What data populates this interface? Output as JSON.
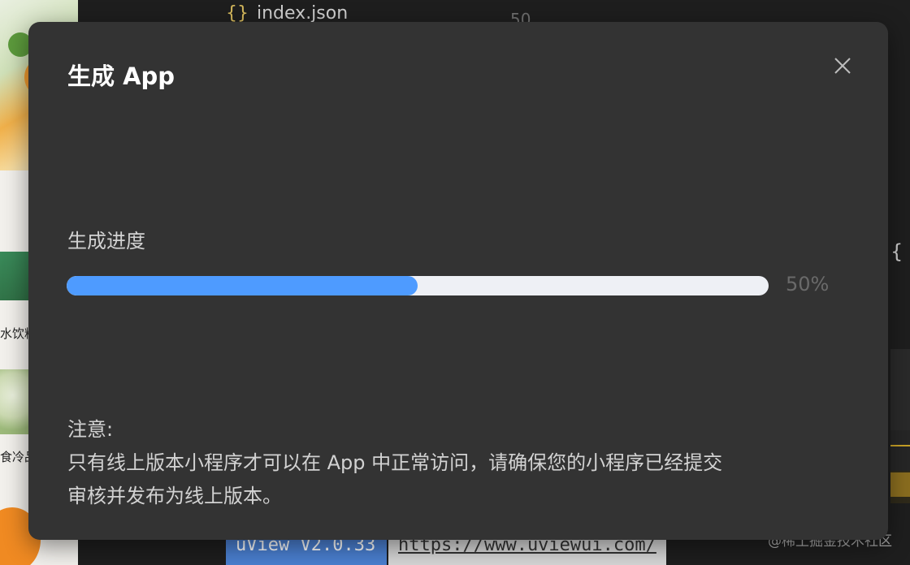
{
  "background": {
    "editor_file_name": "index.json",
    "editor_file_icon": "{}",
    "editor_line_number": "50",
    "editor_brace": "{",
    "strip_labels": [
      "水饮料",
      "食冷品"
    ],
    "bottom_bar_blue": "uView V2.0.33",
    "bottom_bar_link": "https://www.uviewui.com/",
    "watermark": "@稀土掘金技术社区"
  },
  "modal": {
    "title": "生成 App",
    "close_icon": "close-icon",
    "progress": {
      "label": "生成进度",
      "value": 0.5,
      "percent_text": "50%",
      "fill_color": "#4e9bff",
      "track_color": "#eef0f5"
    },
    "notice": {
      "heading": "注意:",
      "line1": "只有线上版本小程序才可以在 App 中正常访问，请确保您的小程序已经提交",
      "line2": "审核并发布为线上版本。"
    }
  }
}
